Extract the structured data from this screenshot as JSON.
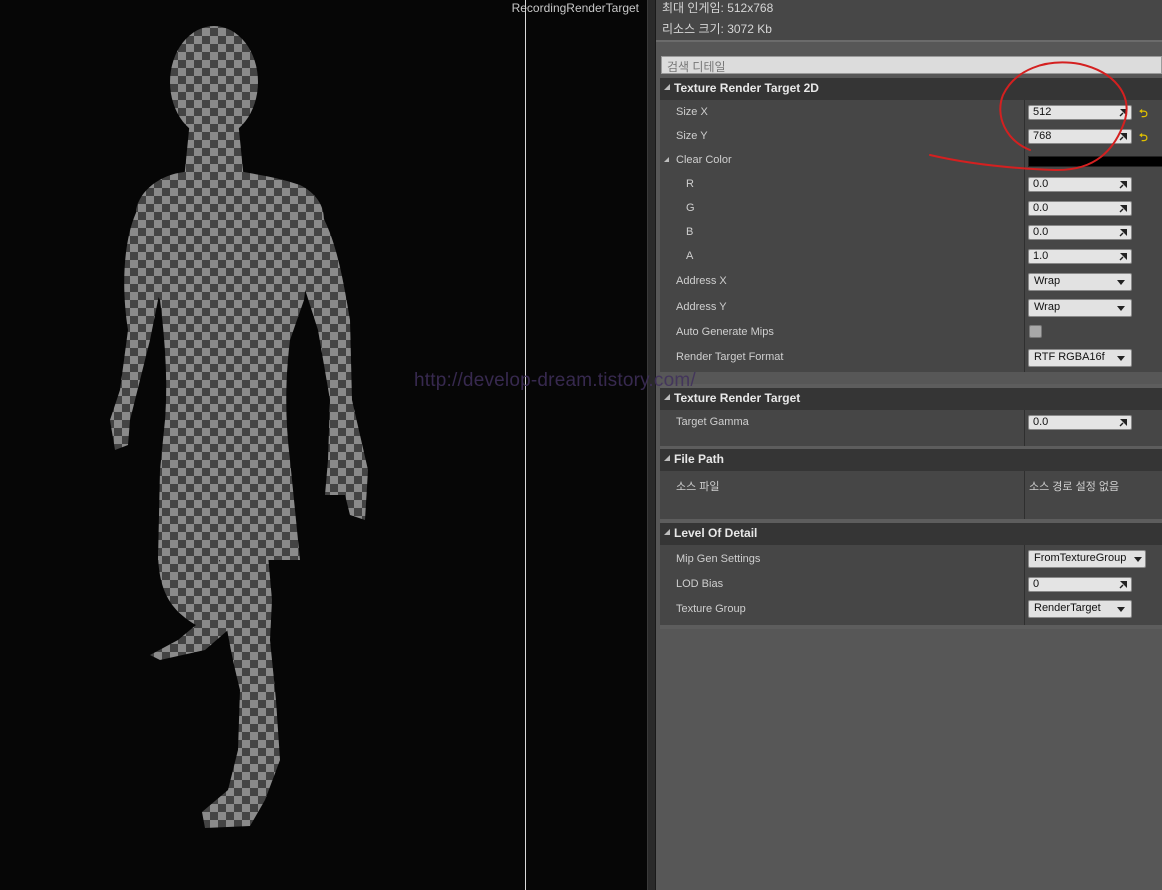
{
  "viewport": {
    "title": "RecordingRenderTarget"
  },
  "info": {
    "max_ingame": "최대 인게임: 512x768",
    "resource_size": "리소스 크기: 3072 Kb"
  },
  "search": {
    "placeholder": "검색 디테일"
  },
  "sections": {
    "texture_render_target_2d": {
      "title": "Texture Render Target 2D",
      "size_x_label": "Size X",
      "size_x_value": "512",
      "size_y_label": "Size Y",
      "size_y_value": "768",
      "clear_color_label": "Clear Color",
      "r_label": "R",
      "r_value": "0.0",
      "g_label": "G",
      "g_value": "0.0",
      "b_label": "B",
      "b_value": "0.0",
      "a_label": "A",
      "a_value": "1.0",
      "address_x_label": "Address X",
      "address_x_value": "Wrap",
      "address_y_label": "Address Y",
      "address_y_value": "Wrap",
      "auto_mips_label": "Auto Generate Mips",
      "auto_mips_checked": false,
      "format_label": "Render Target Format",
      "format_value": "RTF RGBA16f"
    },
    "texture_render_target": {
      "title": "Texture Render Target",
      "gamma_label": "Target Gamma",
      "gamma_value": "0.0"
    },
    "file_path": {
      "title": "File Path",
      "source_label": "소스 파일",
      "source_value": "소스 경로 설정 없음"
    },
    "level_of_detail": {
      "title": "Level Of Detail",
      "mip_label": "Mip Gen Settings",
      "mip_value": "FromTextureGroup",
      "lod_label": "LOD Bias",
      "lod_value": "0",
      "group_label": "Texture Group",
      "group_value": "RenderTarget"
    }
  },
  "overlay": {
    "watermark": "http://develop-dream.tistory.com/"
  },
  "colors": {
    "clear_color": "#000000",
    "reset_arrow": "#e0c000",
    "annotation": "#d42020"
  },
  "icons": [
    "reset-to-default-icon",
    "drag-grip-icon",
    "dropdown-caret-icon",
    "expand-arrow-icon"
  ]
}
